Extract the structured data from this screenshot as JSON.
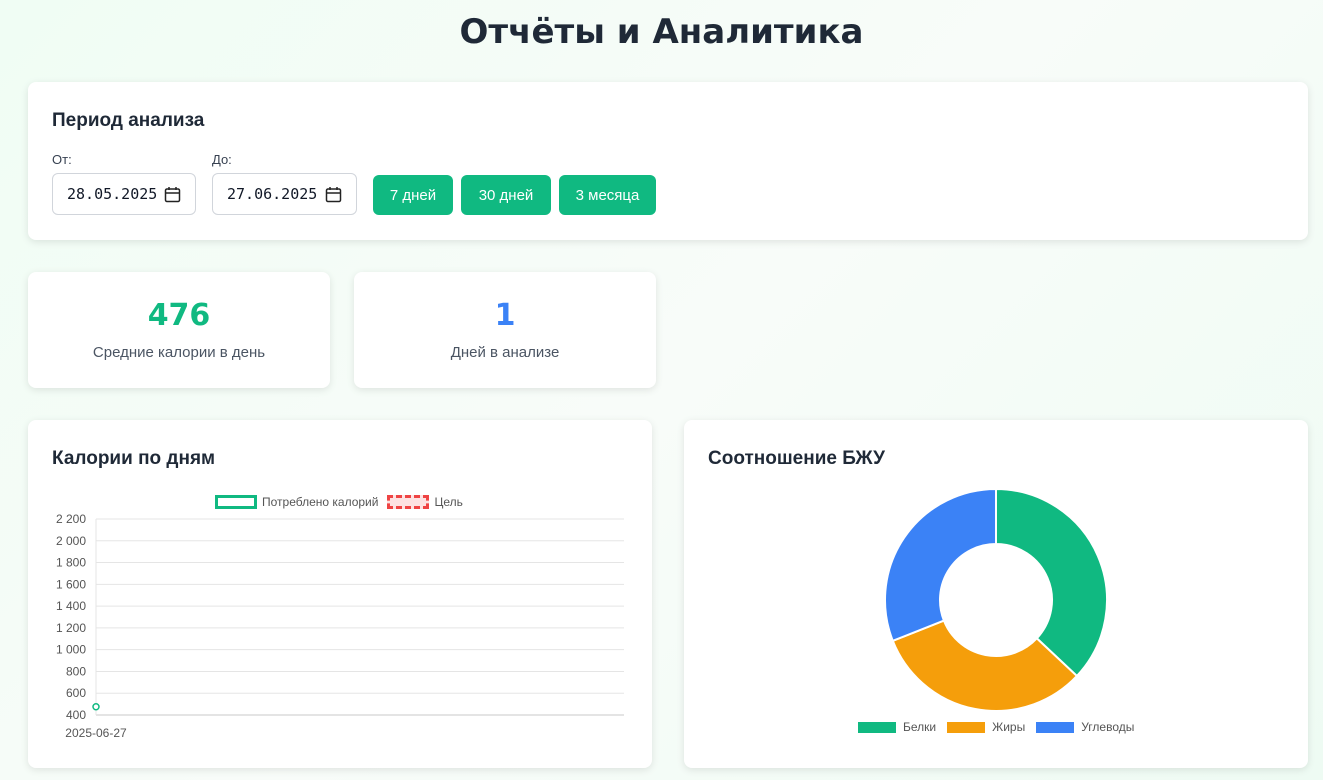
{
  "page": {
    "title": "Отчёты и Аналитика"
  },
  "period": {
    "title": "Период анализа",
    "from_label": "От:",
    "from_value": "28.05.2025",
    "to_label": "До:",
    "to_value": "27.06.2025",
    "quick_buttons": [
      "7 дней",
      "30 дней",
      "3 месяца"
    ]
  },
  "stats": [
    {
      "value": "476",
      "label": "Средние калории в день",
      "color": "#10b981"
    },
    {
      "value": "1",
      "label": "Дней в анализе",
      "color": "#3b82f6"
    }
  ],
  "calories_chart": {
    "title": "Калории по дням",
    "legend": [
      "Потреблено калорий",
      "Цель"
    ]
  },
  "macro_chart": {
    "title": "Соотношение БЖУ",
    "legend": [
      "Белки",
      "Жиры",
      "Углеводы"
    ]
  },
  "chart_data": [
    {
      "type": "line",
      "title": "Калории по дням",
      "x": [
        "2025-06-27"
      ],
      "series": [
        {
          "name": "Потреблено калорий",
          "values": [
            476
          ],
          "color": "#10b981"
        },
        {
          "name": "Цель",
          "values": [],
          "color": "#ef4444"
        }
      ],
      "ylim": [
        400,
        2200
      ],
      "yticks": [
        "2 200",
        "2 000",
        "1 800",
        "1 600",
        "1 400",
        "1 200",
        "1 000",
        "800",
        "600",
        "400"
      ],
      "grid": true,
      "legend": "top"
    },
    {
      "type": "pie",
      "title": "Соотношение БЖУ",
      "categories": [
        "Белки",
        "Жиры",
        "Углеводы"
      ],
      "values": [
        37,
        32,
        31
      ],
      "colors": [
        "#10b981",
        "#f59e0b",
        "#3b82f6"
      ],
      "legend": "bottom"
    }
  ]
}
